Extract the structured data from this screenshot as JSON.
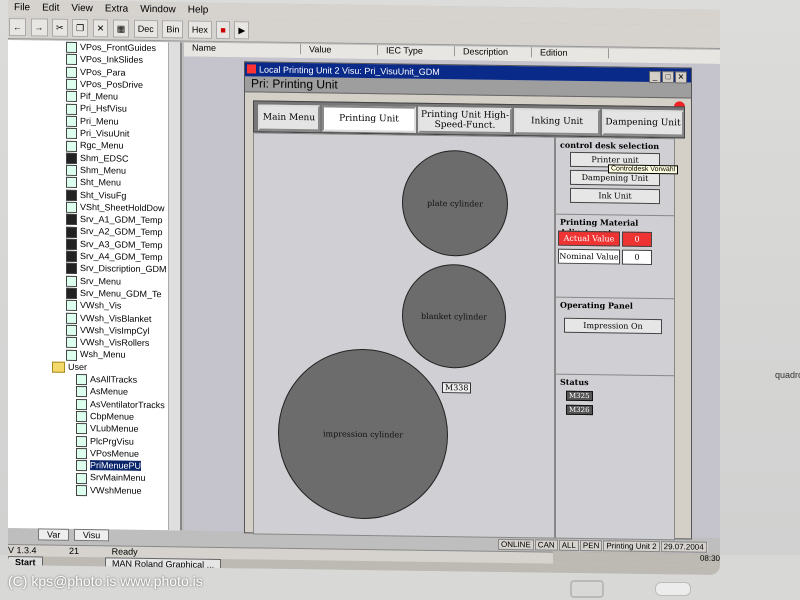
{
  "menu": [
    "File",
    "Edit",
    "View",
    "Extra",
    "Window",
    "Help"
  ],
  "toolbar": {
    "dec": "Dec",
    "bin": "Bin",
    "hex": "Hex"
  },
  "tree": [
    {
      "label": "VPos_FrontGuides",
      "dark": false
    },
    {
      "label": "VPos_InkSlides",
      "dark": false
    },
    {
      "label": "VPos_Para",
      "dark": false
    },
    {
      "label": "VPos_PosDrive",
      "dark": false
    },
    {
      "label": "Pif_Menu",
      "dark": false
    },
    {
      "label": "Pri_HsfVisu",
      "dark": false
    },
    {
      "label": "Pri_Menu",
      "dark": false
    },
    {
      "label": "Pri_VisuUnit",
      "dark": false
    },
    {
      "label": "Rgc_Menu",
      "dark": false
    },
    {
      "label": "Shm_EDSC",
      "dark": true
    },
    {
      "label": "Shm_Menu",
      "dark": false
    },
    {
      "label": "Sht_Menu",
      "dark": false
    },
    {
      "label": "Sht_VisuFg",
      "dark": true
    },
    {
      "label": "VSht_SheetHoldDow",
      "dark": false
    },
    {
      "label": "Srv_A1_GDM_Temp",
      "dark": true
    },
    {
      "label": "Srv_A2_GDM_Temp",
      "dark": true
    },
    {
      "label": "Srv_A3_GDM_Temp",
      "dark": true
    },
    {
      "label": "Srv_A4_GDM_Temp",
      "dark": true
    },
    {
      "label": "Srv_Discription_GDM",
      "dark": true
    },
    {
      "label": "Srv_Menu",
      "dark": false
    },
    {
      "label": "Srv_Menu_GDM_Te",
      "dark": true
    },
    {
      "label": "VWsh_Vis",
      "dark": false
    },
    {
      "label": "VWsh_VisBlanket",
      "dark": false
    },
    {
      "label": "VWsh_VisImpCyl",
      "dark": false
    },
    {
      "label": "VWsh_VisRollers",
      "dark": false
    },
    {
      "label": "Wsh_Menu",
      "dark": false
    }
  ],
  "tree_folder": "User",
  "tree_user": [
    "AsAllTracks",
    "AsMenue",
    "AsVentilatorTracks",
    "CbpMenue",
    "VLubMenue",
    "PlcPrgVisu",
    "VPosMenue",
    "PriMenuePU",
    "SrvMainMenu",
    "VWshMenue"
  ],
  "tree_selected": "PriMenuePU",
  "bottom_tabs": [
    "Var",
    "Visu"
  ],
  "statusbar": {
    "version": "V 1.3.4",
    "num": "21",
    "state": "Ready"
  },
  "taskbar": {
    "start": "Start",
    "app": "MAN Roland Graphical ..."
  },
  "columns": [
    "Name",
    "Value",
    "IEC Type",
    "Description",
    "Edition"
  ],
  "window": {
    "title": "Local Printing Unit 2 Visu: Pri_VisuUnit_GDM",
    "vis_title": "Pri: Printing Unit"
  },
  "nav": [
    {
      "label": "Main Menu",
      "active": false
    },
    {
      "label": "Printing Unit",
      "active": true
    },
    {
      "label": "Printing Unit High-Speed-Funct.",
      "active": false
    },
    {
      "label": "Inking Unit",
      "active": false
    },
    {
      "label": "Dampening Unit",
      "active": false
    }
  ],
  "cylinders": {
    "plate": "plate cylinder",
    "blanket": "blanket cylinder",
    "impression": "impression cylinder",
    "tag": "M338"
  },
  "panel": {
    "desk_title": "control desk selection",
    "desk_buttons": [
      "Printer unit",
      "Dampening Unit",
      "Ink Unit"
    ],
    "tooltip": "Controldesk Vorwahl",
    "material_title": "Printing Material Adjustment",
    "actual_label": "Actual Value",
    "actual_value": "0",
    "nominal_label": "Nominal Value",
    "nominal_value": "0",
    "operating_title": "Operating Panel",
    "impression_button": "Impression On",
    "status_title": "Status",
    "status_tags": [
      "M325",
      "M326"
    ]
  },
  "tray": {
    "online": "ONLINE",
    "can": "CAN",
    "all": "ALL",
    "pen": "PEN",
    "unit": "Printing Unit 2",
    "date": "29.07.2004",
    "time": "08:30"
  },
  "copyright": "(C) kps@photo.is  www.photo.is",
  "brand": "quadrol"
}
